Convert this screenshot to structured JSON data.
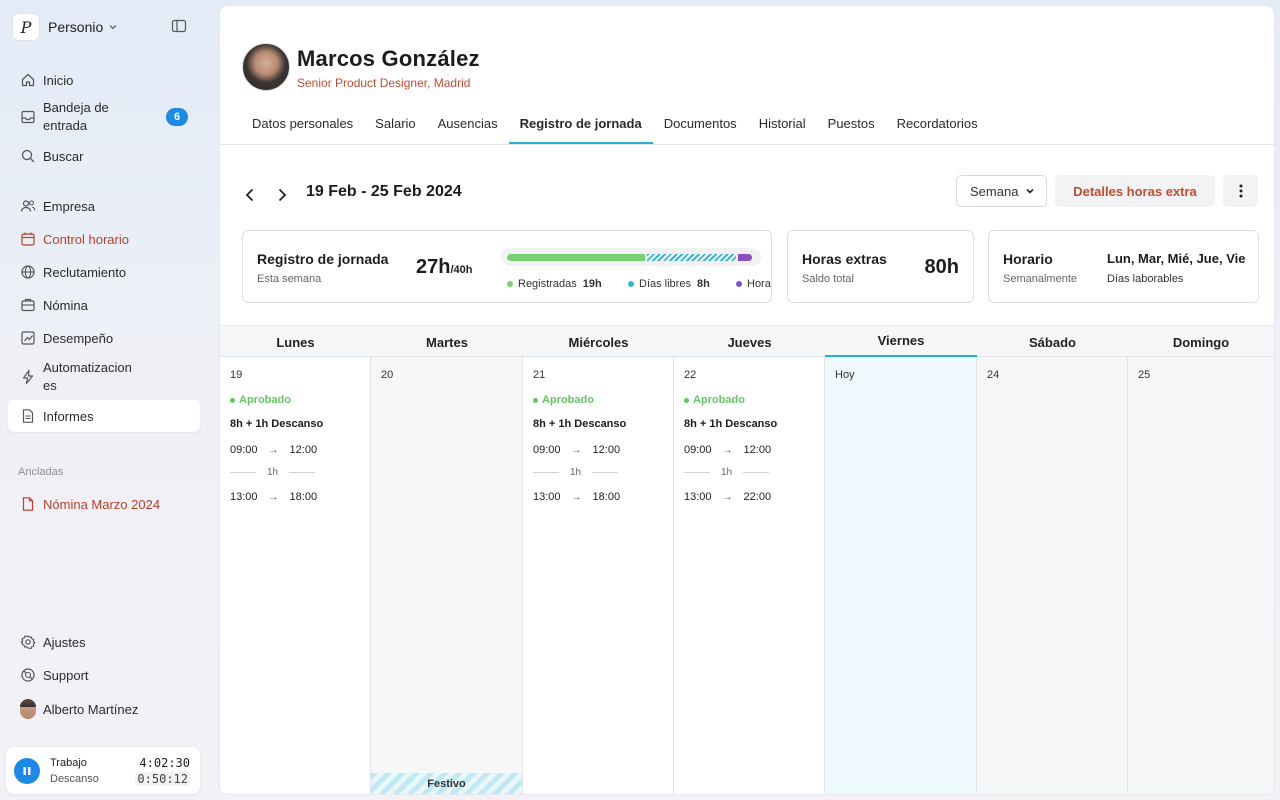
{
  "brand": {
    "name": "Personio",
    "logo_glyph": "P"
  },
  "sidebar": {
    "items": [
      {
        "label": "Inicio",
        "icon": "home-icon"
      },
      {
        "label": "Bandeja de entrada",
        "icon": "inbox-icon",
        "badge": "6"
      },
      {
        "label": "Buscar",
        "icon": "search-icon"
      },
      {
        "label": "Empresa",
        "icon": "people-icon"
      },
      {
        "label": "Control horario",
        "icon": "calendar-icon"
      },
      {
        "label": "Reclutamiento",
        "icon": "globe-icon"
      },
      {
        "label": "Nómina",
        "icon": "payroll-icon"
      },
      {
        "label": "Desempeño",
        "icon": "chart-icon"
      },
      {
        "label": "Automatizaciones",
        "icon": "bolt-icon"
      },
      {
        "label": "Informes",
        "icon": "report-icon"
      }
    ],
    "pinned_label": "Ancladas",
    "pinned_items": [
      {
        "label": "Nómina Marzo 2024",
        "icon": "document-icon"
      }
    ],
    "bottom_items": [
      {
        "label": "Ajustes",
        "icon": "gear-icon"
      },
      {
        "label": "Support",
        "icon": "help-icon"
      },
      {
        "label": "Alberto Martínez",
        "icon": "avatar"
      }
    ],
    "timer": {
      "work_label": "Trabajo",
      "work_value": "4:02:30",
      "break_label": "Descanso",
      "break_value": "0:50:12"
    }
  },
  "profile": {
    "name": "Marcos González",
    "role": "Senior Product Designer, Madrid"
  },
  "tabs": [
    "Datos personales",
    "Salario",
    "Ausencias",
    "Registro de jornada",
    "Documentos",
    "Historial",
    "Puestos",
    "Recordatorios"
  ],
  "toolbar": {
    "date_range": "19 Feb - 25 Feb 2024",
    "view_select": "Semana",
    "overtime_button": "Detalles horas extra"
  },
  "cards": {
    "timesheet": {
      "title": "Registro de jornada",
      "subtitle": "Esta semana",
      "hours": "27h",
      "target": "/40h",
      "legend": [
        {
          "label": "Registradas",
          "value": "19h",
          "color": "#77d172"
        },
        {
          "label": "Días libres",
          "value": "8h",
          "color": "#34b6d3"
        },
        {
          "label": "Horas extra",
          "value": "",
          "color": "#8a4fbf"
        }
      ]
    },
    "overtime": {
      "title": "Horas extras",
      "subtitle": "Saldo total",
      "value": "80h"
    },
    "schedule": {
      "title": "Horario",
      "subtitle": "Semanalmente",
      "days": "Lun, Mar, Mié, Jue, Vie",
      "days_sub": "Días laborables"
    }
  },
  "calendar": {
    "days": [
      {
        "name": "Lunes",
        "num": "19",
        "status": "Aprobado",
        "hours": "8h + 1h Descanso",
        "in1": "09:00",
        "out1": "12:00",
        "break": "1h",
        "in2": "13:00",
        "out2": "18:00"
      },
      {
        "name": "Martes",
        "num": "20",
        "holiday": "Festivo"
      },
      {
        "name": "Miércoles",
        "num": "21",
        "status": "Aprobado",
        "hours": "8h + 1h Descanso",
        "in1": "09:00",
        "out1": "12:00",
        "break": "1h",
        "in2": "13:00",
        "out2": "18:00"
      },
      {
        "name": "Jueves",
        "num": "22",
        "status": "Aprobado",
        "hours": "8h + 1h Descanso",
        "in1": "09:00",
        "out1": "12:00",
        "break": "1h",
        "in2": "13:00",
        "out2": "22:00"
      },
      {
        "name": "Viernes",
        "num": "Hoy"
      },
      {
        "name": "Sábado",
        "num": "24"
      },
      {
        "name": "Domingo",
        "num": "25"
      }
    ],
    "arrow": "→"
  }
}
